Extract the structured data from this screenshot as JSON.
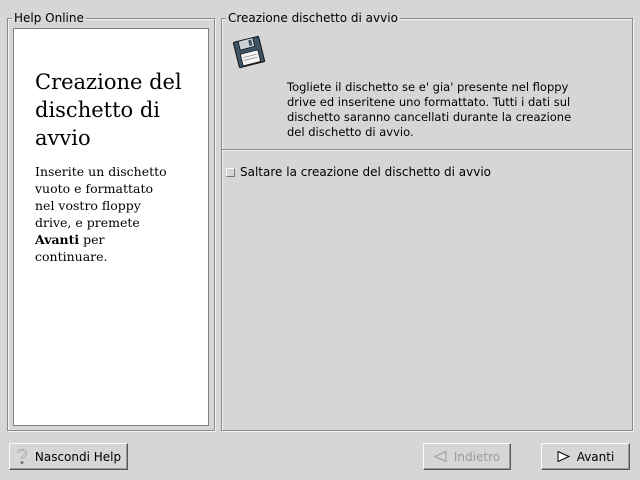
{
  "help_panel": {
    "frame_title": "Help Online",
    "heading": "Creazione del dischetto di avvio",
    "body_before": "Inserite un dischetto vuoto e formattato nel vostro floppy drive, e premete ",
    "body_bold": "Avanti",
    "body_after": " per continuare."
  },
  "main_panel": {
    "frame_title": "Creazione dischetto di avvio",
    "icon": "floppy-disk-icon",
    "instructions": "Togliete il dischetto se e' gia' presente nel floppy drive ed inseritene uno formattato. Tutti i dati sul dischetto saranno cancellati durante la creazione del dischetto di avvio.",
    "skip_checkbox": {
      "label": "Saltare la creazione del dischetto di avvio",
      "checked": false
    }
  },
  "buttons": {
    "hide_help": {
      "label": "Nascondi Help",
      "icon": "question-mark-icon"
    },
    "back": {
      "label": "Indietro",
      "icon": "left-triangle-icon",
      "enabled": false
    },
    "next": {
      "label": "Avanti",
      "icon": "right-triangle-icon",
      "enabled": true
    }
  },
  "colors": {
    "window_bg": "#d6d6d6",
    "help_bg": "#ffffff",
    "disabled_text": "#9a9a9a"
  }
}
